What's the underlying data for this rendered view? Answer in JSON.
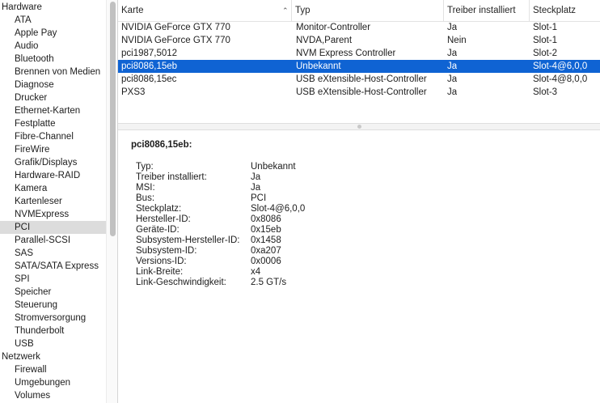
{
  "sidebar": {
    "items": [
      {
        "label": "Hardware",
        "kind": "group",
        "selected": false
      },
      {
        "label": "ATA",
        "kind": "child",
        "selected": false
      },
      {
        "label": "Apple Pay",
        "kind": "child",
        "selected": false
      },
      {
        "label": "Audio",
        "kind": "child",
        "selected": false
      },
      {
        "label": "Bluetooth",
        "kind": "child",
        "selected": false
      },
      {
        "label": "Brennen von Medien",
        "kind": "child",
        "selected": false
      },
      {
        "label": "Diagnose",
        "kind": "child",
        "selected": false
      },
      {
        "label": "Drucker",
        "kind": "child",
        "selected": false
      },
      {
        "label": "Ethernet-Karten",
        "kind": "child",
        "selected": false
      },
      {
        "label": "Festplatte",
        "kind": "child",
        "selected": false
      },
      {
        "label": "Fibre-Channel",
        "kind": "child",
        "selected": false
      },
      {
        "label": "FireWire",
        "kind": "child",
        "selected": false
      },
      {
        "label": "Grafik/Displays",
        "kind": "child",
        "selected": false
      },
      {
        "label": "Hardware-RAID",
        "kind": "child",
        "selected": false
      },
      {
        "label": "Kamera",
        "kind": "child",
        "selected": false
      },
      {
        "label": "Kartenleser",
        "kind": "child",
        "selected": false
      },
      {
        "label": "NVMExpress",
        "kind": "child",
        "selected": false
      },
      {
        "label": "PCI",
        "kind": "child",
        "selected": true
      },
      {
        "label": "Parallel-SCSI",
        "kind": "child",
        "selected": false
      },
      {
        "label": "SAS",
        "kind": "child",
        "selected": false
      },
      {
        "label": "SATA/SATA Express",
        "kind": "child",
        "selected": false
      },
      {
        "label": "SPI",
        "kind": "child",
        "selected": false
      },
      {
        "label": "Speicher",
        "kind": "child",
        "selected": false
      },
      {
        "label": "Steuerung",
        "kind": "child",
        "selected": false
      },
      {
        "label": "Stromversorgung",
        "kind": "child",
        "selected": false
      },
      {
        "label": "Thunderbolt",
        "kind": "child",
        "selected": false
      },
      {
        "label": "USB",
        "kind": "child",
        "selected": false
      },
      {
        "label": "Netzwerk",
        "kind": "group",
        "selected": false
      },
      {
        "label": "Firewall",
        "kind": "child",
        "selected": false
      },
      {
        "label": "Umgebungen",
        "kind": "child",
        "selected": false
      },
      {
        "label": "Volumes",
        "kind": "child",
        "selected": false
      }
    ]
  },
  "table": {
    "columns": [
      "Karte",
      "Typ",
      "Treiber installiert",
      "Steckplatz"
    ],
    "sort_icon": "sort-ascending-icon",
    "rows": [
      {
        "karte": "NVIDIA GeForce GTX 770",
        "typ": "Monitor-Controller",
        "treiber": "Ja",
        "steckplatz": "Slot-1",
        "selected": false
      },
      {
        "karte": "NVIDIA GeForce GTX 770",
        "typ": "NVDA,Parent",
        "treiber": "Nein",
        "steckplatz": "Slot-1",
        "selected": false
      },
      {
        "karte": "pci1987,5012",
        "typ": "NVM Express Controller",
        "treiber": "Ja",
        "steckplatz": "Slot-2",
        "selected": false
      },
      {
        "karte": "pci8086,15eb",
        "typ": "Unbekannt",
        "treiber": "Ja",
        "steckplatz": "Slot-4@6,0,0",
        "selected": true
      },
      {
        "karte": "pci8086,15ec",
        "typ": "USB eXtensible-Host-Controller",
        "treiber": "Ja",
        "steckplatz": "Slot-4@8,0,0",
        "selected": false
      },
      {
        "karte": "PXS3",
        "typ": "USB eXtensible-Host-Controller",
        "treiber": "Ja",
        "steckplatz": "Slot-3",
        "selected": false
      }
    ]
  },
  "detail": {
    "title": "pci8086,15eb:",
    "properties": [
      {
        "key": "Typ:",
        "value": "Unbekannt"
      },
      {
        "key": "Treiber installiert:",
        "value": "Ja"
      },
      {
        "key": "MSI:",
        "value": "Ja"
      },
      {
        "key": "Bus:",
        "value": "PCI"
      },
      {
        "key": "Steckplatz:",
        "value": "Slot-4@6,0,0"
      },
      {
        "key": "Hersteller-ID:",
        "value": "0x8086"
      },
      {
        "key": "Geräte-ID:",
        "value": "0x15eb"
      },
      {
        "key": "Subsystem-Hersteller-ID:",
        "value": "0x1458"
      },
      {
        "key": "Subsystem-ID:",
        "value": "0xa207"
      },
      {
        "key": "Versions-ID:",
        "value": "0x0006"
      },
      {
        "key": "Link-Breite:",
        "value": "x4"
      },
      {
        "key": "Link-Geschwindigkeit:",
        "value": "2.5 GT/s"
      }
    ]
  },
  "colors": {
    "selection": "#0f63d3",
    "sidebar_selection": "#dcdcdc"
  }
}
